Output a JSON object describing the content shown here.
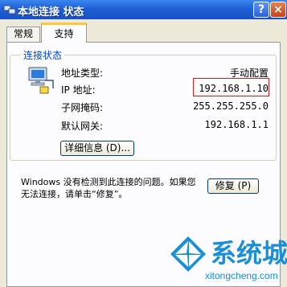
{
  "window": {
    "title": "本地连接 状态",
    "help_label": "?",
    "close_label": "×"
  },
  "tabs": [
    {
      "label": "常规"
    },
    {
      "label": "支持"
    }
  ],
  "status_group": {
    "title": "连接状态",
    "rows": [
      {
        "label": "地址类型:",
        "value": "手动配置"
      },
      {
        "label": "IP 地址:",
        "value": "192.168.1.10"
      },
      {
        "label": "子网掩码:",
        "value": "255.255.255.0"
      },
      {
        "label": "默认网关:",
        "value": "192.168.1.1"
      }
    ],
    "details_button": "详细信息 (D)..."
  },
  "message": "Windows 没有检测到此连接的问题。如果您无法连接，请单击“修复”。",
  "repair_button": "修复 (P)",
  "watermark": {
    "brand": "系统城",
    "url": "xitongcheng.com"
  },
  "colors": {
    "titlebar": "#1f5fd6",
    "group_title": "#0046d5",
    "highlight": "#cc2020",
    "watermark": "#1a8fd8"
  },
  "icons": {
    "title": "network-connection-icon",
    "status": "network-computer-icon"
  }
}
